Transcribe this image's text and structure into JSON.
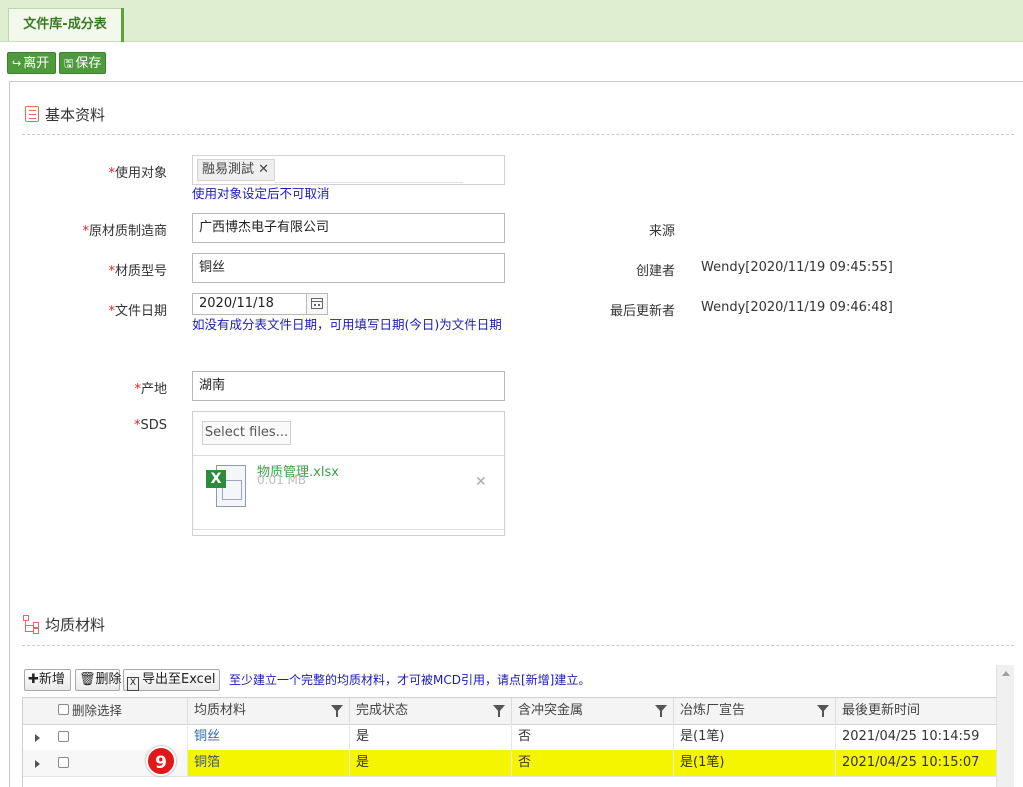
{
  "tab": {
    "title": "文件库-成分表"
  },
  "toolbar": {
    "leave_label": "离开",
    "save_label": "保存"
  },
  "basic_section": {
    "title": "基本资料"
  },
  "form": {
    "target": {
      "label": "使用对象",
      "tag": "融易測試",
      "hint": "使用对象设定后不可取消"
    },
    "manufacturer": {
      "label": "原材质制造商",
      "value": "广西博杰电子有限公司"
    },
    "model": {
      "label": "材质型号",
      "value": "铜丝"
    },
    "doc_date": {
      "label": "文件日期",
      "value": "2020/11/18",
      "hint": "如没有成分表文件日期，可用填写日期(今日)为文件日期"
    },
    "origin": {
      "label": "产地",
      "value": "湖南"
    },
    "sds": {
      "label": "SDS",
      "select_label": "Select files...",
      "file_name": "物质管理.xlsx",
      "file_size": "0.01 MB"
    },
    "required_mark": "*"
  },
  "info": {
    "source": {
      "label": "来源",
      "value": ""
    },
    "creator": {
      "label": "创建者",
      "value": "Wendy[2020/11/19 09:45:55]"
    },
    "updater": {
      "label": "最后更新者",
      "value": "Wendy[2020/11/19 09:46:48]"
    }
  },
  "homog_section": {
    "title": "均质材料"
  },
  "grid_toolbar": {
    "add_label": "新增",
    "delete_label": "删除",
    "export_label": "导出至Excel",
    "notice": "至少建立一个完整的均质材料，才可被MCD引用，请点[新增]建立。"
  },
  "grid": {
    "columns": [
      "删除选择",
      "均质材料",
      "完成状态",
      "含冲突金属",
      "冶炼厂宣告",
      "最後更新时间"
    ],
    "rows": [
      {
        "material": "铜丝",
        "status": "是",
        "conflict": "否",
        "smelter": "是(1笔)",
        "updated": "2021/04/25 10:14:59",
        "highlight": false
      },
      {
        "material": "铜箔",
        "status": "是",
        "conflict": "否",
        "smelter": "是(1笔)",
        "updated": "2021/04/25 10:15:07",
        "highlight": true
      }
    ]
  },
  "step_badge": "9",
  "colors": {
    "accent_green": "#4e9a3c",
    "highlight": "#f5f500",
    "badge": "#e01818",
    "hint_blue": "#1a1ab8",
    "required_red": "#e01f1f"
  }
}
